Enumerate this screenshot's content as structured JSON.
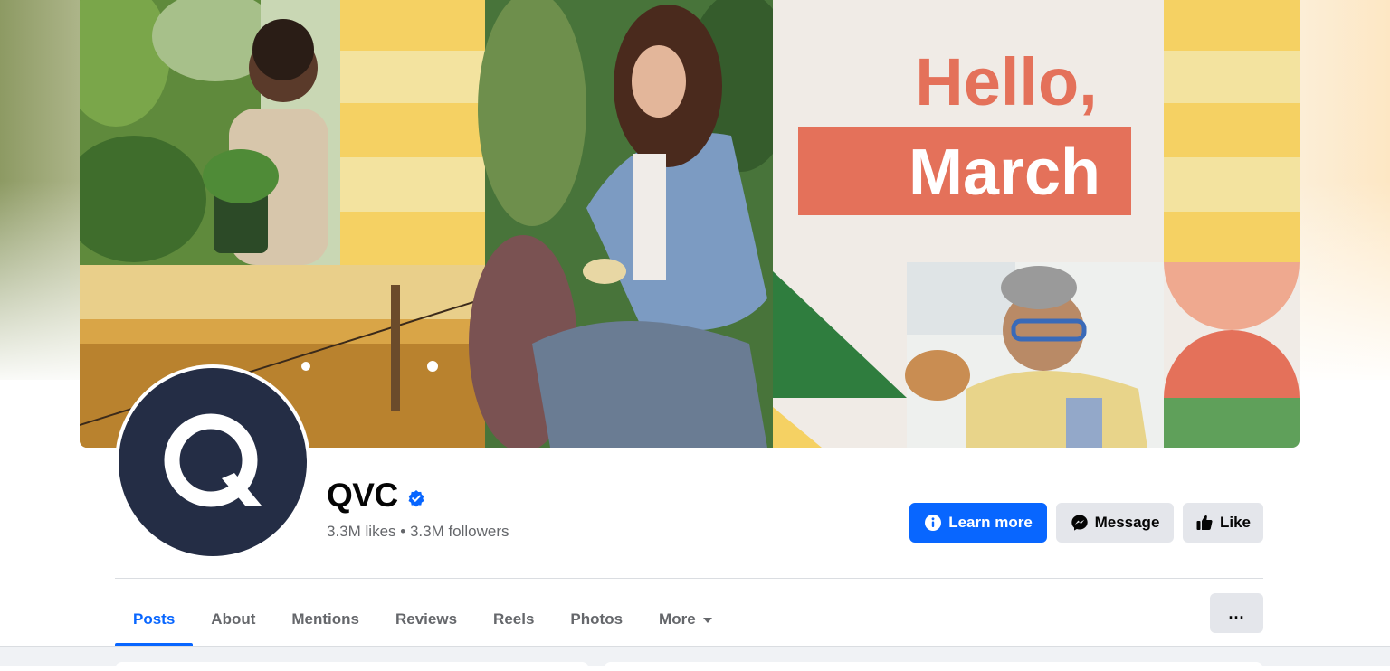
{
  "cover": {
    "headline_line1": "Hello,",
    "headline_line2": "March",
    "colors": {
      "coral": "#e4715a",
      "yellow": "#f5d163",
      "green": "#2f7d3e",
      "navy": "#242d45"
    }
  },
  "profile": {
    "logo_icon": "q-logo-icon",
    "name": "QVC",
    "verified_icon": "verified-badge-icon",
    "likes": "3.3M likes",
    "separator": " • ",
    "followers": "3.3M followers"
  },
  "actions": {
    "learn_more": "Learn more",
    "message": "Message",
    "like": "Like",
    "accent": "#0866ff"
  },
  "tabs": [
    {
      "label": "Posts",
      "active": true
    },
    {
      "label": "About"
    },
    {
      "label": "Mentions"
    },
    {
      "label": "Reviews"
    },
    {
      "label": "Reels"
    },
    {
      "label": "Photos"
    },
    {
      "label": "More"
    }
  ],
  "overflow_button": "..."
}
